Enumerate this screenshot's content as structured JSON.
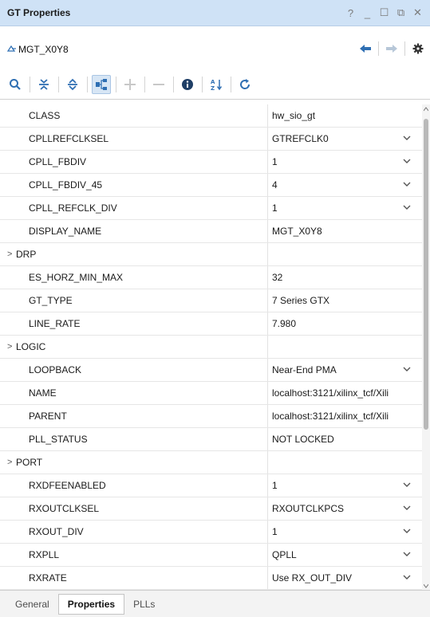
{
  "window": {
    "title": "GT Properties",
    "controls": [
      "?",
      "_",
      "☐",
      "⧉",
      "✕"
    ]
  },
  "object": {
    "name": "MGT_X0Y8",
    "icon": "transceiver-icon"
  },
  "nav": {
    "back_icon": "arrow-left-icon",
    "forward_icon": "arrow-right-icon",
    "settings_icon": "gear-icon"
  },
  "toolbar": {
    "icons": [
      "search-icon",
      "collapse-all-icon",
      "expand-all-icon",
      "group-icon",
      "add-icon",
      "remove-icon",
      "info-icon",
      "sort-az-icon",
      "refresh-icon"
    ]
  },
  "properties": [
    {
      "name": "CLASS",
      "value": "hw_sio_gt",
      "dropdown": false,
      "expandable": false
    },
    {
      "name": "CPLLREFCLKSEL",
      "value": "GTREFCLK0",
      "dropdown": true,
      "expandable": false
    },
    {
      "name": "CPLL_FBDIV",
      "value": "1",
      "dropdown": true,
      "expandable": false
    },
    {
      "name": "CPLL_FBDIV_45",
      "value": "4",
      "dropdown": true,
      "expandable": false
    },
    {
      "name": "CPLL_REFCLK_DIV",
      "value": "1",
      "dropdown": true,
      "expandable": false
    },
    {
      "name": "DISPLAY_NAME",
      "value": "MGT_X0Y8",
      "dropdown": false,
      "expandable": false
    },
    {
      "name": "DRP",
      "value": "",
      "dropdown": false,
      "expandable": true
    },
    {
      "name": "ES_HORZ_MIN_MAX",
      "value": "32",
      "dropdown": false,
      "expandable": false
    },
    {
      "name": "GT_TYPE",
      "value": "7 Series GTX",
      "dropdown": false,
      "expandable": false
    },
    {
      "name": "LINE_RATE",
      "value": "7.980",
      "dropdown": false,
      "expandable": false
    },
    {
      "name": "LOGIC",
      "value": "",
      "dropdown": false,
      "expandable": true
    },
    {
      "name": "LOOPBACK",
      "value": "Near-End PMA",
      "dropdown": true,
      "expandable": false
    },
    {
      "name": "NAME",
      "value": "localhost:3121/xilinx_tcf/Xili",
      "dropdown": false,
      "expandable": false
    },
    {
      "name": "PARENT",
      "value": "localhost:3121/xilinx_tcf/Xili",
      "dropdown": false,
      "expandable": false
    },
    {
      "name": "PLL_STATUS",
      "value": "NOT LOCKED",
      "dropdown": false,
      "expandable": false
    },
    {
      "name": "PORT",
      "value": "",
      "dropdown": false,
      "expandable": true
    },
    {
      "name": "RXDFEENABLED",
      "value": "1",
      "dropdown": true,
      "expandable": false
    },
    {
      "name": "RXOUTCLKSEL",
      "value": "RXOUTCLKPCS",
      "dropdown": true,
      "expandable": false
    },
    {
      "name": "RXOUT_DIV",
      "value": "1",
      "dropdown": true,
      "expandable": false
    },
    {
      "name": "RXPLL",
      "value": "QPLL",
      "dropdown": true,
      "expandable": false
    },
    {
      "name": "RXRATE",
      "value": "Use RX_OUT_DIV",
      "dropdown": true,
      "expandable": false
    }
  ],
  "tabs": [
    {
      "label": "General",
      "active": false
    },
    {
      "label": "Properties",
      "active": true
    },
    {
      "label": "PLLs",
      "active": false
    }
  ],
  "colors": {
    "titlebar": "#cfe2f6",
    "icon_blue": "#2f6fb3",
    "icon_gray": "#5a5a5a"
  }
}
